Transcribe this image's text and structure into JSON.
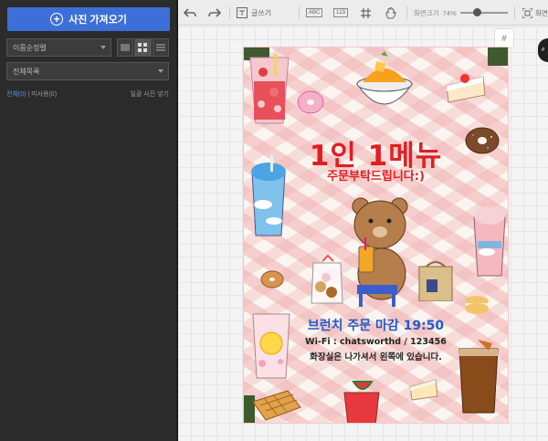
{
  "left_panel": {
    "import_button": "사진 가져오기",
    "sort_select": "이름순정렬",
    "folder_select": "전체목록",
    "filter_all": "전체(0)",
    "filter_separator": " | ",
    "filter_unused": "미사용(0)",
    "bulk_view": "일괄 사진 넣기"
  },
  "toolbar": {
    "text_label": "글쓰기",
    "abc_label": "ABC",
    "num_label": "123",
    "zoom_label": "화면크기",
    "zoom_value": "74%",
    "fit_label": "화면"
  },
  "canvas": {
    "hash_label": "#"
  },
  "poster": {
    "title": "1인 1메뉴",
    "subtitle": "주문부탁드립니다:)",
    "brunch": "브런치 주문 마감 19:50",
    "wifi": "Wi-Fi : chatsworthd / 123456",
    "restroom": "화장실은 나가셔서 왼쪽에 있습니다."
  },
  "colors": {
    "accent_blue": "#3d6fd8",
    "poster_red": "#e01e23",
    "poster_blue": "#2859c9",
    "panel_dark": "#2b2b2b"
  }
}
